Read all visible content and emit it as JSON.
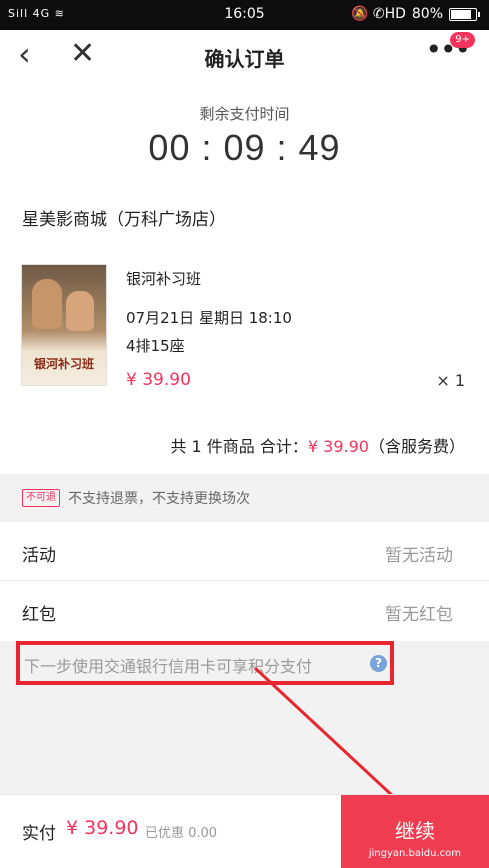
{
  "status_bar": {
    "signal": "Sill 4G ≋",
    "time": "16:05",
    "icons": "🔕 ✆HD",
    "battery": "80%"
  },
  "nav": {
    "back_icon": "‹",
    "close_icon": "✕",
    "title": "确认订单",
    "more_icon": "•••",
    "badge": "9+"
  },
  "countdown": {
    "label": "剩余支付时间",
    "value": "00 : 09 : 49"
  },
  "store": "星美影商城（万科广场店）",
  "order": {
    "poster_title": "银河补习班",
    "movie": "银河补习班",
    "showtime": "07月21日 星期日 18:10",
    "seat": "4排15座",
    "price": "¥ 39.90",
    "quantity": "× 1"
  },
  "summary": {
    "prefix": "共 1 件商品  合计：",
    "total": "¥ 39.90",
    "suffix": "（含服务费）"
  },
  "notice": {
    "tag": "不可退",
    "text": "不支持退票，不支持更换场次"
  },
  "rows": {
    "activity": {
      "label": "活动",
      "value": "暂无活动"
    },
    "redpacket": {
      "label": "红包",
      "value": "暂无红包"
    }
  },
  "promo": {
    "text": "下一步使用交通银行信用卡可享积分支付",
    "help_icon": "?"
  },
  "footer": {
    "paid_label": "实付",
    "paid_amount": "¥ 39.90",
    "discount": "已优惠 0.00",
    "pay_button": "继续",
    "watermark": "jingyan.baidu.com"
  },
  "colors": {
    "accent": "#f5345d",
    "pay_button": "#f03c50",
    "annotation": "#e8262f"
  }
}
